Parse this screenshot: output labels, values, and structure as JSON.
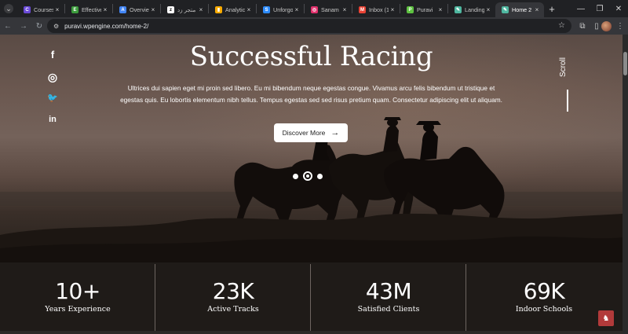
{
  "browser": {
    "tabs": [
      {
        "title": "Courses",
        "icon_color": "#6b4bd8",
        "icon_char": "C"
      },
      {
        "title": "Effective",
        "icon_color": "#3c9c3c",
        "icon_char": "E"
      },
      {
        "title": "Overview",
        "icon_color": "#4285f4",
        "icon_char": "A"
      },
      {
        "title": "متجر زد",
        "icon_color": "#ffffff",
        "icon_char": "z"
      },
      {
        "title": "Analytic",
        "icon_color": "#f9ab00",
        "icon_char": "▮"
      },
      {
        "title": "Unforgo",
        "icon_color": "#2d8cff",
        "icon_char": "S"
      },
      {
        "title": "Sanam",
        "icon_color": "#e1306c",
        "icon_char": "◎"
      },
      {
        "title": "Inbox (1",
        "icon_color": "#ea4335",
        "icon_char": "M"
      },
      {
        "title": "Puravi",
        "icon_color": "#5ec241",
        "icon_char": "P"
      },
      {
        "title": "Landing",
        "icon_color": "#4fb7a0",
        "icon_char": "✎"
      },
      {
        "title": "Home 2",
        "icon_color": "#4fb7a0",
        "icon_char": "✎",
        "active": true
      }
    ],
    "close_glyph": "×",
    "new_tab_glyph": "+",
    "url": "puravi.wpengine.com/home-2/"
  },
  "hero": {
    "title": "Successful Racing",
    "description": "Ultrices dui sapien eget mi proin sed libero. Eu mi bibendum neque egestas congue. Vivamus arcu felis bibendum ut tristique et egestas quis. Eu lobortis elementum nibh tellus. Tempus egestas sed sed risus pretium quam. Consectetur adipiscing elit ut aliquam.",
    "cta_label": "Discover More",
    "cta_arrow": "→",
    "scroll_label": "Scroll",
    "slides_total": 3,
    "slide_active": 2
  },
  "social": [
    {
      "name": "facebook-icon",
      "glyph": "f"
    },
    {
      "name": "instagram-icon",
      "glyph": "◎"
    },
    {
      "name": "twitter-icon",
      "glyph": "🐦"
    },
    {
      "name": "linkedin-icon",
      "glyph": "in"
    }
  ],
  "stats": [
    {
      "value": "10+",
      "label": "Years Experience"
    },
    {
      "value": "23K",
      "label": "Active Tracks"
    },
    {
      "value": "43M",
      "label": "Satisfied Clients"
    },
    {
      "value": "69K",
      "label": "Indoor Schools"
    }
  ],
  "colors": {
    "page_dark": "#1f1b18",
    "to_top_button": "#b23a3a"
  }
}
